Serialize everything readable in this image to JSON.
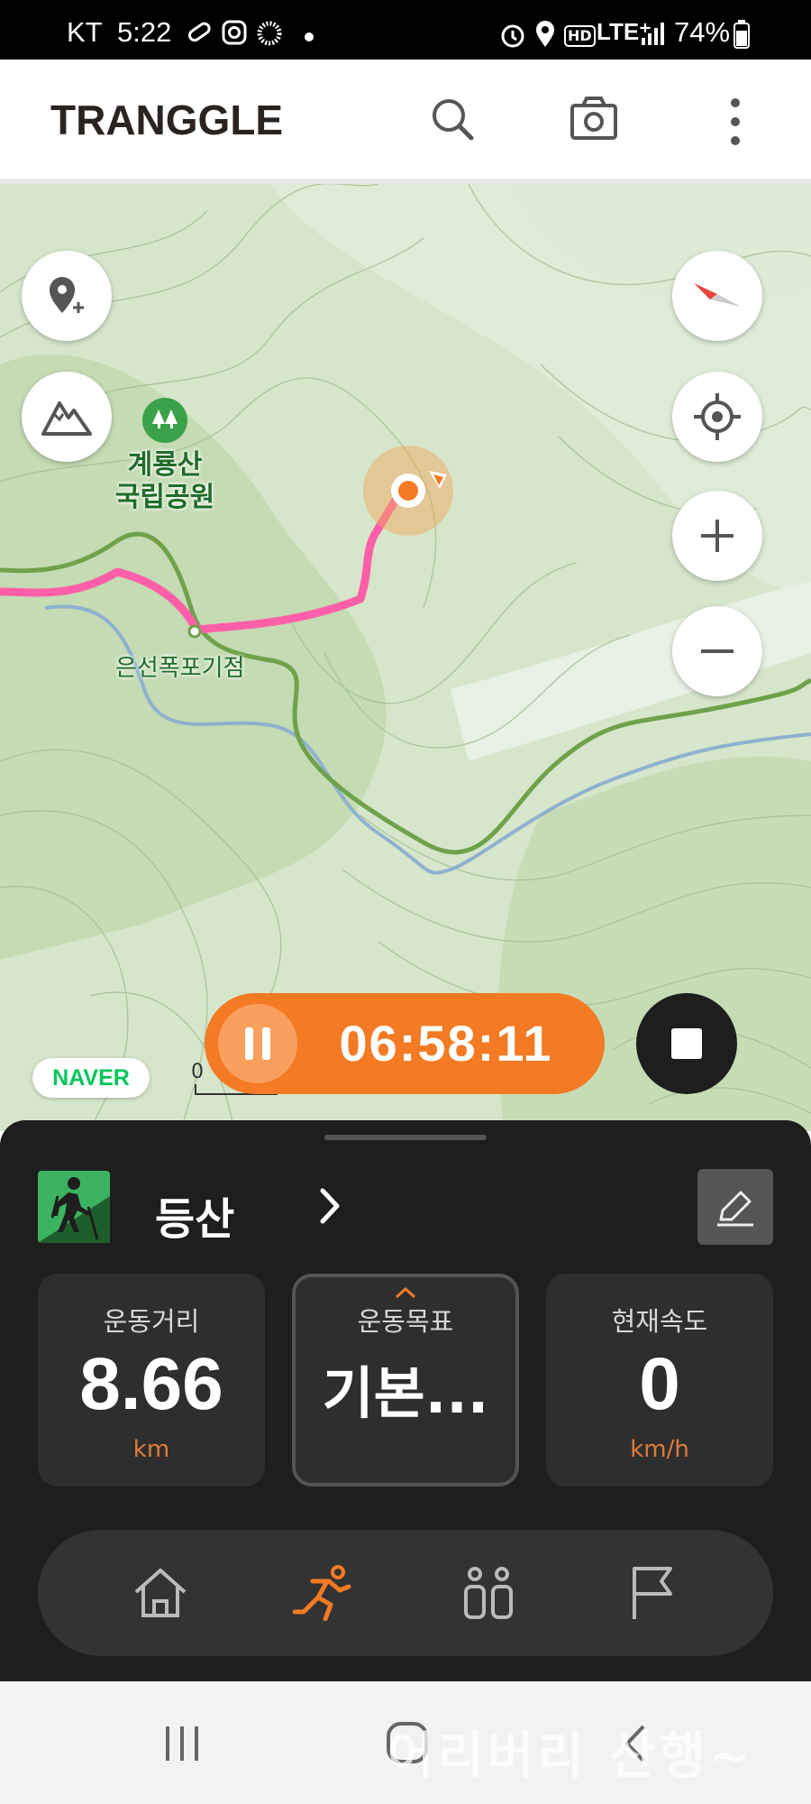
{
  "status_bar": {
    "carrier": "KT",
    "time": "5:22",
    "network": "LTE⁺",
    "battery": "74%"
  },
  "header": {
    "logo": "TRANGGLE",
    "icons": [
      "search-icon",
      "camera-icon",
      "more-icon"
    ]
  },
  "map": {
    "park_label_line1": "계룡산",
    "park_label_line2": "국립공원",
    "waypoint_label": "은선폭포기점",
    "scale_label": "0",
    "naver_badge": "NAVER",
    "route_color": "#ff5fa8",
    "trail_color": "#6fa24a",
    "stream_color": "#8fb1cf"
  },
  "recording": {
    "elapsed_time": "06:58:11",
    "accent_color": "#f47a24"
  },
  "panel": {
    "activity_name": "등산",
    "cards": [
      {
        "label": "운동거리",
        "value": "8.66",
        "unit": "km"
      },
      {
        "label": "운동목표",
        "value": "기본...",
        "unit": ""
      },
      {
        "label": "현재속도",
        "value": "0",
        "unit": "km/h"
      }
    ],
    "nav_items": [
      "home-icon",
      "running-icon",
      "people-icon",
      "flag-icon"
    ],
    "active_nav": "running-icon"
  },
  "watermark": "어리버리 산행~"
}
